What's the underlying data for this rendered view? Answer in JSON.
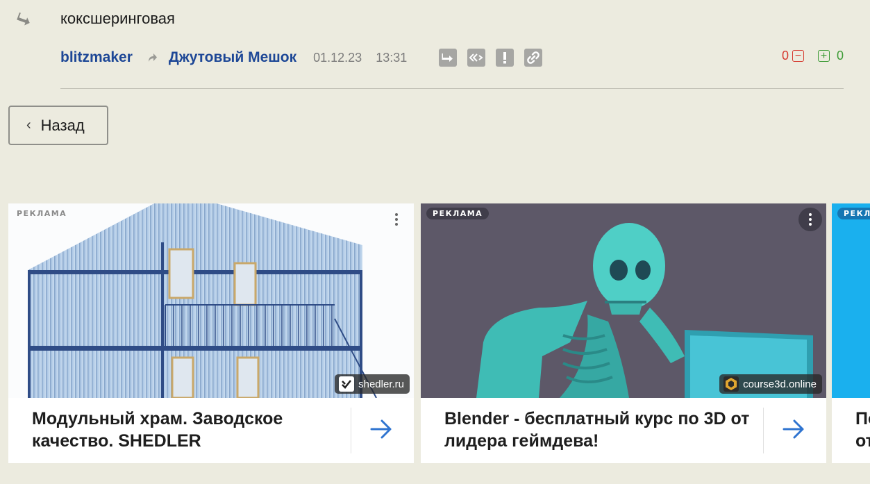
{
  "comment": {
    "text": "коксшеринговая",
    "author": "blitzmaker",
    "parent_author": "Джутовый Мешок",
    "date": "01.12.23",
    "time": "13:31",
    "icons": [
      "reply-icon",
      "quote-icon",
      "report-icon",
      "link-icon"
    ]
  },
  "votes": {
    "down_count": "0",
    "down_symbol": "−",
    "up_symbol": "+",
    "up_count": "0",
    "down_color": "#d6392f",
    "up_color": "#3d9b36"
  },
  "navigation": {
    "back_chevron": "‹",
    "back_label": "Назад"
  },
  "ads": [
    {
      "label": "РЕКЛАМА",
      "source": "shedler.ru",
      "title": "Модульный храм. Заводское качество. SHEDLER"
    },
    {
      "label": "РЕКЛАМА",
      "source": "course3d.online",
      "title": "Blender - бесплатный курс по 3D от лидера геймдева!"
    },
    {
      "label": "РЕКЛ",
      "title": "По от"
    }
  ],
  "colors": {
    "background": "#ecebdf",
    "link": "#1d4796",
    "accent_arrow": "#2f74d0"
  }
}
